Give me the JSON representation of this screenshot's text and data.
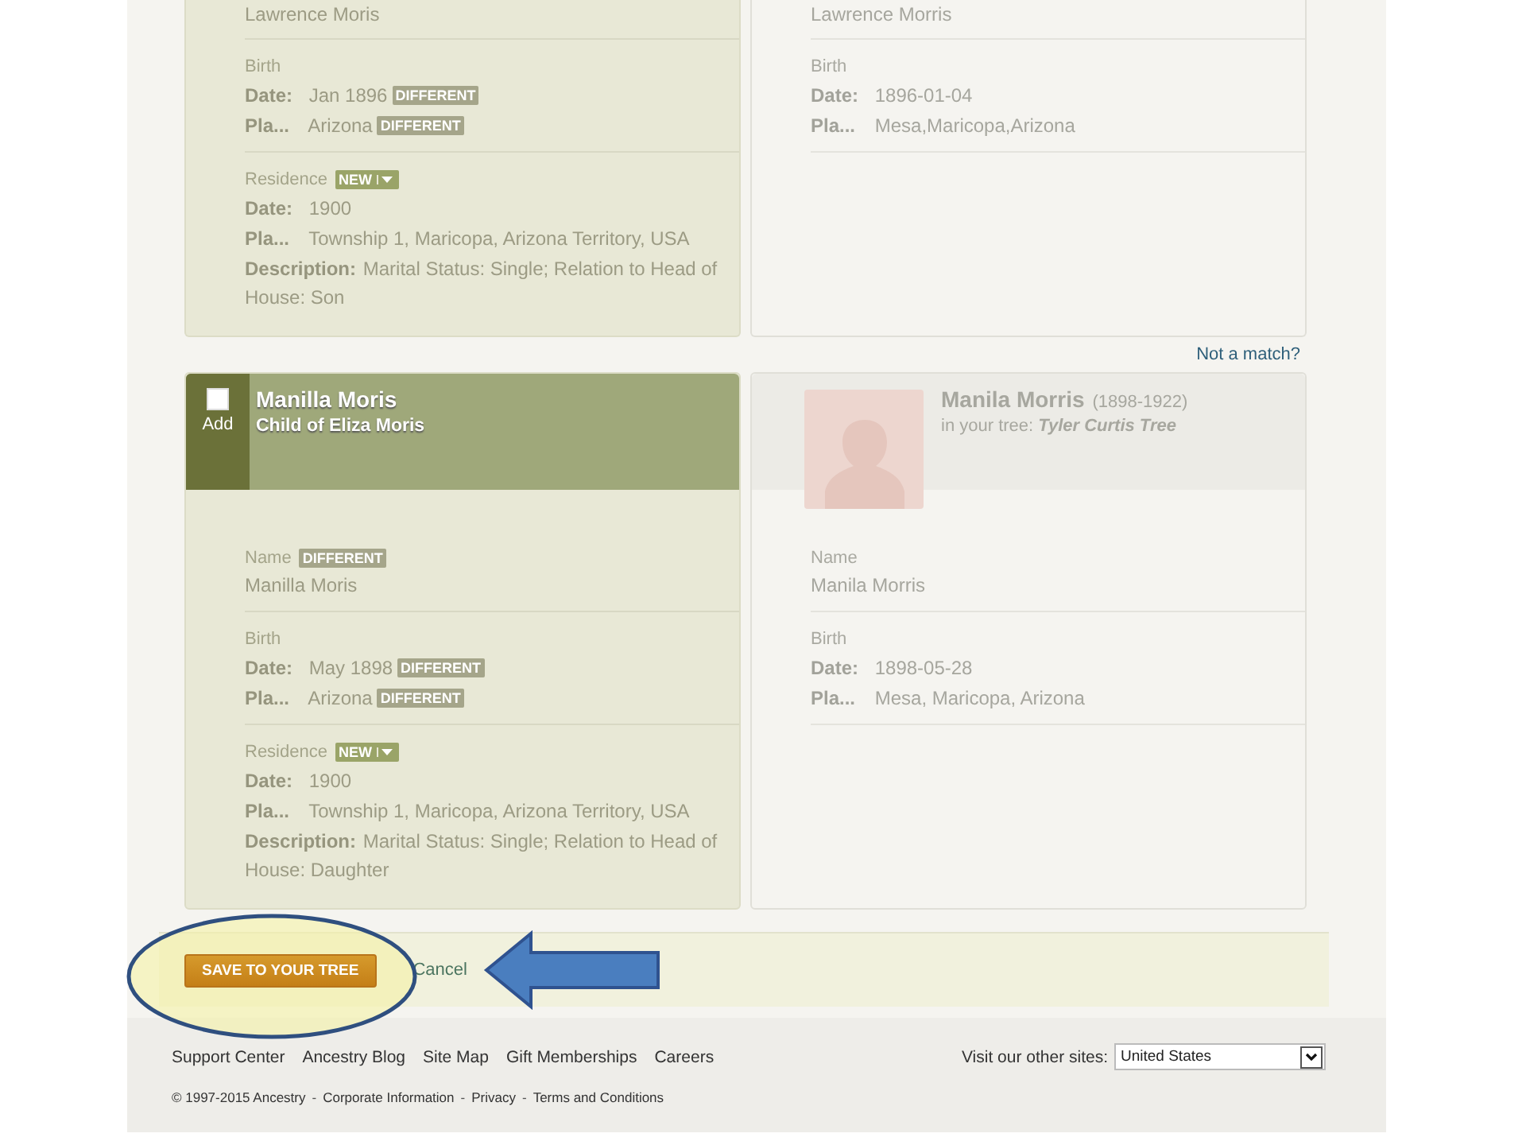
{
  "records": [
    {
      "suggested": {
        "sections": [
          {
            "kind": "name",
            "value": "Lawrence Moris"
          },
          {
            "kind": "event",
            "title": "Birth",
            "lines": [
              {
                "label": "Date:",
                "value": "Jan 1896",
                "tag": {
                  "kind": "different",
                  "text": "DIFFERENT"
                }
              },
              {
                "label": "Pla...",
                "value": "Arizona",
                "tag": {
                  "kind": "different",
                  "text": "DIFFERENT"
                }
              }
            ]
          },
          {
            "kind": "event",
            "title": "Residence",
            "tag": {
              "kind": "new",
              "text": "NEW"
            },
            "lines": [
              {
                "label": "Date:",
                "value": "1900"
              },
              {
                "label": "Pla...",
                "value": "Township 1, Maricopa, Arizona Territory, USA"
              },
              {
                "label": "Description:",
                "value": "Marital Status: Single; Relation to Head of House: Son"
              }
            ]
          }
        ]
      },
      "tree": {
        "sections": [
          {
            "kind": "name",
            "value": "Lawrence Morris"
          },
          {
            "kind": "event",
            "title": "Birth",
            "lines": [
              {
                "label": "Date:",
                "value": "1896-01-04"
              },
              {
                "label": "Pla...",
                "value": "Mesa,Maricopa,Arizona"
              }
            ]
          }
        ]
      }
    },
    {
      "not_a_match": "Not a match?",
      "suggested": {
        "header": {
          "checked": false,
          "add_label": "Add",
          "name": "Manilla Moris",
          "relation": "Child of Eliza Moris"
        },
        "sections": [
          {
            "kind": "name",
            "title": "Name",
            "tag": {
              "kind": "different",
              "text": "DIFFERENT"
            },
            "value": "Manilla Moris"
          },
          {
            "kind": "event",
            "title": "Birth",
            "lines": [
              {
                "label": "Date:",
                "value": "May 1898",
                "tag": {
                  "kind": "different",
                  "text": "DIFFERENT"
                }
              },
              {
                "label": "Pla...",
                "value": "Arizona",
                "tag": {
                  "kind": "different",
                  "text": "DIFFERENT"
                }
              }
            ]
          },
          {
            "kind": "event",
            "title": "Residence",
            "tag": {
              "kind": "new",
              "text": "NEW"
            },
            "lines": [
              {
                "label": "Date:",
                "value": "1900"
              },
              {
                "label": "Pla...",
                "value": "Township 1, Maricopa, Arizona Territory, USA"
              },
              {
                "label": "Description:",
                "value": "Marital Status: Single; Relation to Head of House: Daughter"
              }
            ]
          }
        ]
      },
      "tree": {
        "header": {
          "name": "Manila Morris",
          "years": "(1898-1922)",
          "tree_label": "in your tree:",
          "tree_name": "Tyler Curtis Tree"
        },
        "sections": [
          {
            "kind": "name",
            "title": "Name",
            "value": "Manila Morris"
          },
          {
            "kind": "event",
            "title": "Birth",
            "lines": [
              {
                "label": "Date:",
                "value": "1898-05-28"
              },
              {
                "label": "Pla...",
                "value": "Mesa, Maricopa, Arizona"
              }
            ]
          }
        ]
      }
    }
  ],
  "actions": {
    "save": "SAVE TO YOUR TREE",
    "cancel": "Cancel"
  },
  "footer": {
    "links": [
      "Support Center",
      "Ancestry Blog",
      "Site Map",
      "Gift Memberships",
      "Careers"
    ],
    "other_sites_label": "Visit our other sites:",
    "other_sites_value": "United States",
    "legal": [
      "© 1997-2015 Ancestry",
      "Corporate Information",
      "Privacy",
      "Terms and Conditions"
    ],
    "separator": "-"
  }
}
